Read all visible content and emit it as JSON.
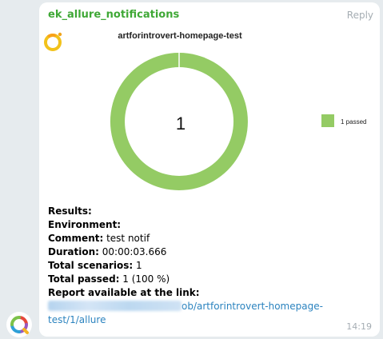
{
  "message": {
    "sender": "ek_allure_notifications",
    "reply_label": "Reply",
    "time": "14:19"
  },
  "report_image": {
    "title": "artforintrovert-homepage-test",
    "center_value": "1",
    "legend_label": "1 passed",
    "passed_color": "#94cb64"
  },
  "chart_data": {
    "type": "pie",
    "title": "artforintrovert-homepage-test",
    "categories": [
      "passed"
    ],
    "values": [
      1
    ],
    "legend": [
      "1 passed"
    ],
    "legend_position": "right",
    "colors": [
      "#94cb64"
    ]
  },
  "body_text": {
    "results": "Results:",
    "environment": "Environment:",
    "comment_label": "Comment:",
    "comment_value": " test notif",
    "duration_label": "Duration:",
    "duration_value": " 00:00:03.666",
    "total_scenarios_label": "Total scenarios:",
    "total_scenarios_value": " 1",
    "total_passed_label": "Total passed:",
    "total_passed_value": " 1 (100 %)",
    "report_link_label": "Report available at the link:",
    "link_visible_part1": "ob/artforintrovert-homepage-",
    "link_visible_part2": "test/1/allure"
  },
  "icons": {
    "bot_avatar": "allure-logo-icon",
    "report_logo": "allure-logo-icon"
  }
}
